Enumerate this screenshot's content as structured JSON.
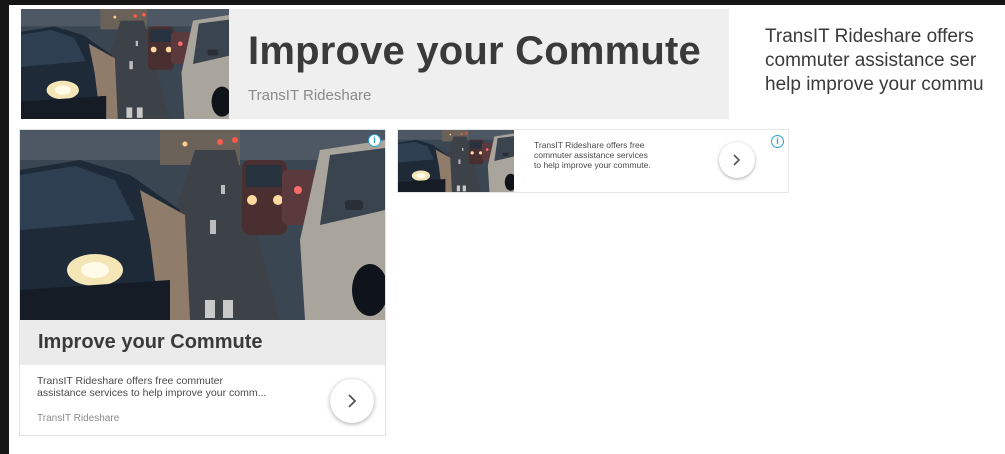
{
  "ad": {
    "title": "Improve your Commute",
    "brand": "TransIT Rideshare",
    "description": "TransIT Rideshare offers free commuter assistance services to help improve your commute.",
    "banner_description": "TransIT Rideshare offers\ncommuter assistance ser\nhelp improve your commu",
    "large_description": "TransIT Rideshare offers free commuter\nassistance services to help improve your comm...",
    "small_description": "TransIT Rideshare offers free\ncommuter assistance services\nto help improve your commute.",
    "adchoices_glyph": "i",
    "image_icon": "traffic-photo",
    "arrow_icon": "chevron-right-icon"
  },
  "colors": {
    "title_text": "#3a3a3a",
    "title_band": "#ebebeb",
    "adchoices": "#2a9fd6"
  }
}
